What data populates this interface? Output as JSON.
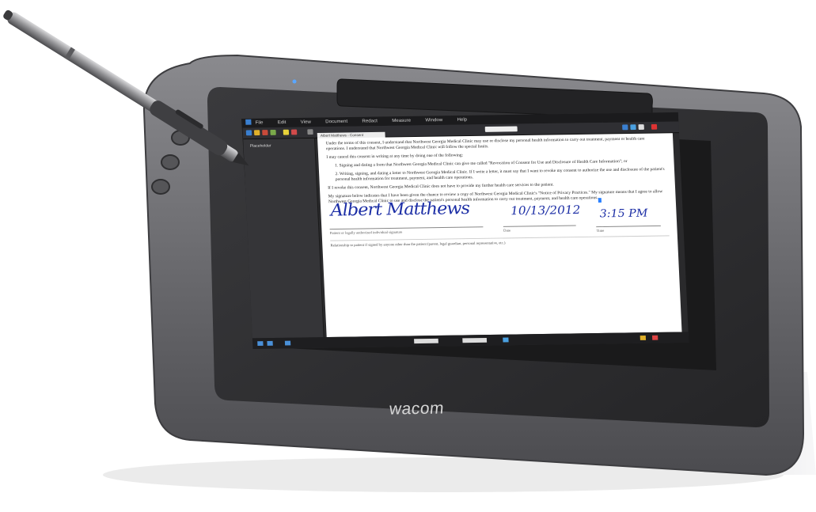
{
  "brand": {
    "logo_text": "wacom"
  },
  "app": {
    "menu": [
      "File",
      "Edit",
      "View",
      "Document",
      "Redact",
      "Measure",
      "Window",
      "Help"
    ],
    "tabs": [
      "Albert Matthews - Consent"
    ],
    "sidebar_label": "Placeholder"
  },
  "document": {
    "paragraphs": [
      "Under the terms of this consent, I understand that Northwest Georgia Medical Clinic may use or disclose my personal health information to carry out treatment, payment or health care operations. I understand that Northwest Georgia Medical Clinic will follow the special limits.",
      "I may cancel this consent in writing at any time by doing one of the following:",
      "1. Signing and dating a form that Northwest Georgia Medical Clinic can give me called \"Revocation of Consent for Use and Disclosure of Health Care Information\"; or",
      "2. Writing, signing, and dating a letter to Northwest Georgia Medical Clinic. If I write a letter, it must say that I want to revoke my consent to authorize the use and disclosure of the patient's personal health information for treatment, payment, and health care operations.",
      "If I revoke this consent, Northwest Georgia Medical Clinic does not have to provide my further health care services to the patient.",
      "My signature below indicates that I have been given the chance to review a copy of Northwest Georgia Medical Clinic's \"Notice of Privacy Practices.\" My signature means that I agree to allow Northwest Georgia Medical Clinic to use and disclose the patient's personal health information to carry out treatment, payment, and health care operations."
    ],
    "signature": "Albert Matthews",
    "signature_caption": "Patient or legally authorized individual signature",
    "date_value": "10/13/2012",
    "date_caption": "Date",
    "time_value": "3:15 PM",
    "time_caption": "Time",
    "footnote": "Relationship to patient if signed by anyone other than the patient (parent, legal guardian, personal representative, etc.)"
  },
  "colors": {
    "ink": "#1d2fa6",
    "device_bezel": "#2c2c2e",
    "device_frame": "#6b6b6f",
    "led": "#5aa7ff"
  }
}
